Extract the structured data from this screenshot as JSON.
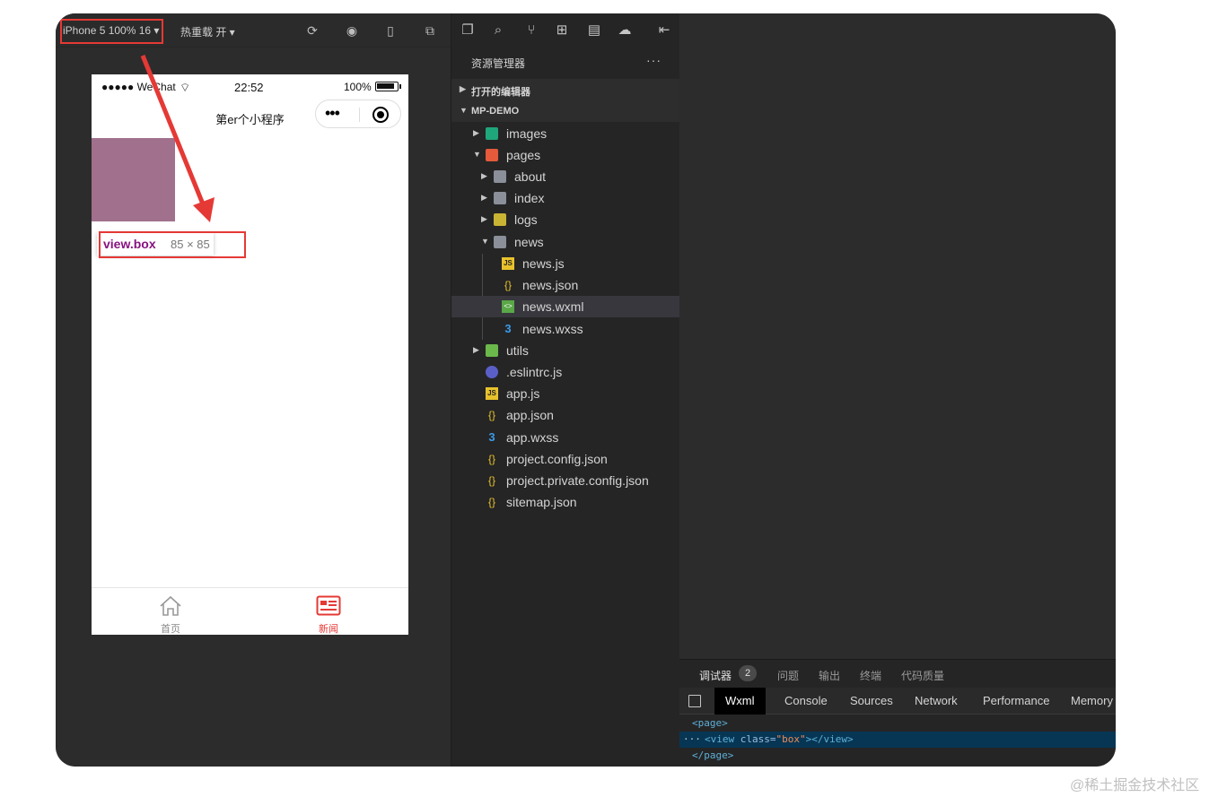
{
  "simulator": {
    "device_selector": "iPhone 5 100% 16 ▾",
    "hot_reload": "热重载 开 ▾",
    "toolbar_icons": [
      "refresh-icon",
      "record-icon",
      "phone-icon",
      "window-icon"
    ]
  },
  "phone": {
    "carrier": "●●●●● WeChat",
    "time": "22:52",
    "battery": "100%",
    "nav_title": "第er个小程序",
    "capsule_more": "•••",
    "tooltip": {
      "selector": "view.box",
      "size": "85 × 85"
    },
    "tabs": [
      {
        "label": "首页",
        "icon": "home-icon",
        "active": false
      },
      {
        "label": "新闻",
        "icon": "news-icon",
        "active": true
      }
    ],
    "box_color": "#a0708c",
    "active_tab_color": "#e53935"
  },
  "explorer": {
    "title": "资源管理器",
    "more": "···",
    "open_editors": "打开的编辑器",
    "project": "MP-DEMO",
    "activity_icons": [
      "files-icon",
      "search-icon",
      "source-control-icon",
      "extensions-icon",
      "remote-icon",
      "docker-icon",
      "collapse-icon"
    ],
    "tree": [
      {
        "label": "images",
        "icon": "folder-images-icon"
      },
      {
        "label": "pages",
        "icon": "folder-pages-icon"
      },
      {
        "label": "about",
        "icon": "folder-icon"
      },
      {
        "label": "index",
        "icon": "folder-icon"
      },
      {
        "label": "logs",
        "icon": "folder-logs-icon"
      },
      {
        "label": "news",
        "icon": "folder-open-icon"
      },
      {
        "label": "news.js",
        "icon": "js-icon"
      },
      {
        "label": "news.json",
        "icon": "json-icon"
      },
      {
        "label": "news.wxml",
        "icon": "wxml-icon"
      },
      {
        "label": "news.wxss",
        "icon": "css-icon"
      },
      {
        "label": "utils",
        "icon": "folder-utils-icon"
      },
      {
        "label": ".eslintrc.js",
        "icon": "eslint-icon"
      },
      {
        "label": "app.js",
        "icon": "js-icon"
      },
      {
        "label": "app.json",
        "icon": "json-icon"
      },
      {
        "label": "app.wxss",
        "icon": "css-icon"
      },
      {
        "label": "project.config.json",
        "icon": "json-icon"
      },
      {
        "label": "project.private.config.json",
        "icon": "json-icon"
      },
      {
        "label": "sitemap.json",
        "icon": "json-icon"
      }
    ]
  },
  "devtools": {
    "top_tabs": [
      "调试器",
      "问题",
      "输出",
      "终端",
      "代码质量"
    ],
    "badge": "2",
    "panel_tabs": [
      "Wxml",
      "Console",
      "Sources",
      "Network",
      "Performance",
      "Memory"
    ],
    "dom": {
      "open_page": "<page>",
      "view_open": "<view ",
      "attr_name": "class=",
      "attr_value": "\"box\"",
      "view_close": "></view>",
      "close_page": "</page>",
      "dots": "···"
    }
  },
  "watermark": "@稀土掘金技术社区"
}
